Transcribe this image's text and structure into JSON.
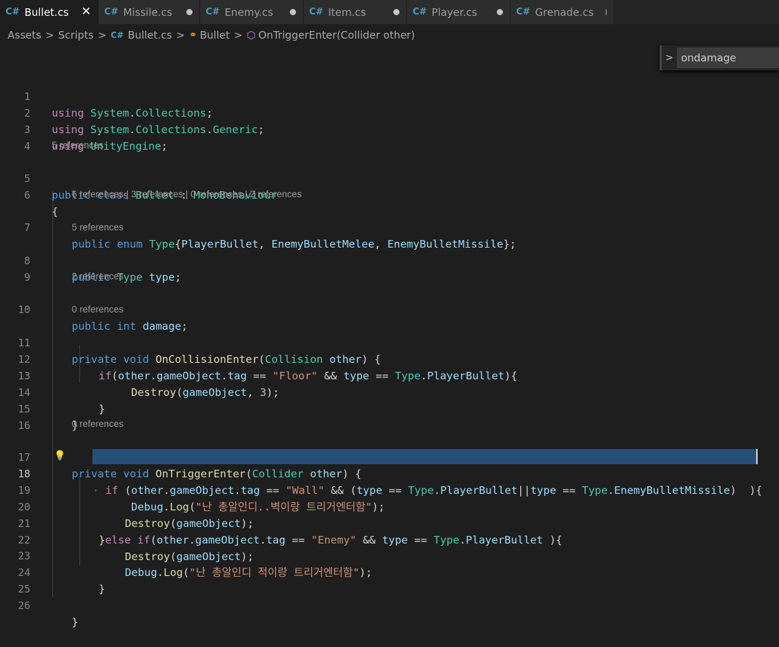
{
  "tabs": [
    {
      "icon": "C#",
      "label": "Bullet.cs",
      "active": true
    },
    {
      "icon": "C#",
      "label": "Missile.cs"
    },
    {
      "icon": "C#",
      "label": "Enemy.cs"
    },
    {
      "icon": "C#",
      "label": "Item.cs"
    },
    {
      "icon": "C#",
      "label": "Player.cs"
    },
    {
      "icon": "C#",
      "label": "Grenade.cs"
    }
  ],
  "breadcrumb": {
    "assets": "Assets",
    "scripts": "Scripts",
    "file": "Bullet.cs",
    "cls": "Bullet",
    "method": "OnTriggerEnter(Collider other)"
  },
  "find": {
    "value": "ondamage"
  },
  "lens": {
    "l5": "5 references",
    "l7": "6 references | 3 references | 0 references | 2 references",
    "l8": "5 references",
    "l10": "2 references",
    "l11": "0 references",
    "l17": "0 references"
  },
  "line_numbers": [
    "1",
    "2",
    "3",
    "4",
    "5",
    "6",
    "7",
    "8",
    "9",
    "10",
    "11",
    "12",
    "13",
    "14",
    "15",
    "16",
    "17",
    "18",
    "19",
    "20",
    "21",
    "22",
    "23",
    "24",
    "25",
    "26"
  ],
  "code": {
    "using": "using",
    "system": "System",
    "collections": "Collections",
    "generic": "Generic",
    "unityengine": "UnityEngine",
    "public": "public",
    "class": "class",
    "bullet": "Bullet",
    "monobehaviour": "MonoBehaviour",
    "enum": "enum",
    "type_cls": "Type",
    "playerbullet": "PlayerBullet",
    "enemybulletmelee": "EnemyBulletMelee",
    "enemybulletmissile": "EnemyBulletMissile",
    "type_var": "type",
    "int": "int",
    "damage": "damage",
    "private": "private",
    "void": "void",
    "oncollisionenter": "OnCollisionEnter",
    "collision": "Collision",
    "other": "other",
    "if": "if",
    "gameobject": "gameObject",
    "tag": "tag",
    "floor": "\"Floor\"",
    "destroy": "Destroy",
    "three": "3",
    "ontriggerenter": "OnTriggerEnter",
    "collider": "Collider",
    "wall": "\"Wall\"",
    "debug": "Debug",
    "log": "Log",
    "msg1": "\"난 총알인디..벽이랑 트리거엔터함\"",
    "else": "else",
    "enemy": "\"Enemy\"",
    "msg2": "\"난 총알인디 적이랑 트리거엔터함\""
  },
  "colors": {
    "keyword": "#569cd6",
    "control": "#c586c0",
    "type": "#4ec9b0",
    "function": "#dcdcaa",
    "variable": "#9cdcfe",
    "string": "#ce9178",
    "number": "#b5cea8",
    "selection": "#264f78"
  }
}
